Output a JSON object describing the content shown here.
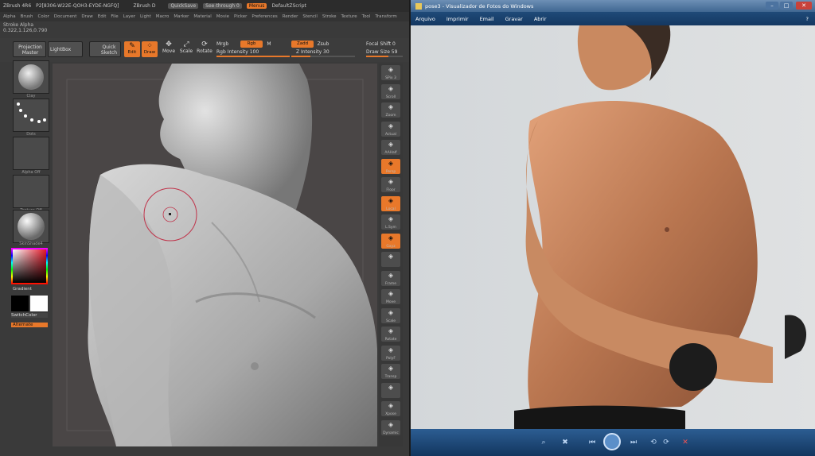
{
  "zbrush": {
    "title": "ZBrush 4R6",
    "title_extra": "P2[8306-W22E-QOH3-EYDE-NGFQ]",
    "doc": "ZBrush D",
    "quicksave": "QuickSave",
    "seethrough": "See-through",
    "seethrough_val": "0",
    "menus_label": "Menus",
    "script": "DefaultZScript",
    "menu": [
      "Alpha",
      "Brush",
      "Color",
      "Document",
      "Draw",
      "Edit",
      "File",
      "Layer",
      "Light",
      "Macro",
      "Marker",
      "Material",
      "Movie",
      "Picker",
      "Preferences",
      "Render",
      "Stencil",
      "Stroke",
      "Texture",
      "Tool",
      "Transform"
    ],
    "info_line1": "Stroke  Alpha",
    "info_line2": "0.322,1.126,0.790",
    "projection_master": "Projection Master",
    "lightbox": "LightBox",
    "quick_sketch": "Quick Sketch",
    "edit": "Edit",
    "draw": "Draw",
    "move": "Move",
    "scale": "Scale",
    "rotate": "Rotate",
    "mrgb": "Mrgb",
    "rgb": "Rgb",
    "m": "M",
    "rgb_intensity": "Rgb Intensity 100",
    "zadd": "Zadd",
    "zsub": "Zsub",
    "z_intensity": "Z Intensity 30",
    "z_intensity_value": 0.3,
    "focal_shift": "Focal Shift 0",
    "draw_size": "Draw Size 59",
    "draw_size_value": 0.6,
    "left": {
      "brush_label": "Clay",
      "stroke_label": "Dots",
      "alpha_label": "Alpha Off",
      "texture_label": "Texture Off",
      "material_label": "SkinShade4",
      "gradient": "Gradient",
      "switchcolor": "SwitchColor",
      "alternate": "Alternate"
    },
    "right": [
      {
        "icon": "bpr-icon",
        "label": "SPix 3"
      },
      {
        "icon": "scroll-icon",
        "label": "Scroll"
      },
      {
        "icon": "zoom-icon",
        "label": "Zoom"
      },
      {
        "icon": "actual-icon",
        "label": "Actual"
      },
      {
        "icon": "aahalf-icon",
        "label": "AAHalf"
      },
      {
        "icon": "persp-icon",
        "label": "Persp",
        "active": true
      },
      {
        "icon": "floor-icon",
        "label": "Floor"
      },
      {
        "icon": "local-icon",
        "label": "Local",
        "active": true
      },
      {
        "icon": "lsym-icon",
        "label": "L.Sym"
      },
      {
        "icon": "xyz-icon",
        "label": "Gxyz",
        "active": true
      },
      {
        "icon": "rotate-icon",
        "label": ""
      },
      {
        "icon": "frame-icon",
        "label": "Frame"
      },
      {
        "icon": "move-icon",
        "label": "Move"
      },
      {
        "icon": "scale-icon",
        "label": "Scale"
      },
      {
        "icon": "rotate-icon",
        "label": "Rotate"
      },
      {
        "icon": "polyf-icon",
        "label": "PolyF"
      },
      {
        "icon": "transp-icon",
        "label": "Transp"
      },
      {
        "icon": "solo-icon",
        "label": ""
      },
      {
        "icon": "xpose-icon",
        "label": "Xpose"
      },
      {
        "icon": "dynamic-icon",
        "label": "Dynamic"
      }
    ]
  },
  "viewer": {
    "title": "pose3 - Visualizador de Fotos do Windows",
    "menu": [
      "Arquivo",
      "Imprimir",
      "Email",
      "Gravar",
      "Abrir"
    ]
  }
}
